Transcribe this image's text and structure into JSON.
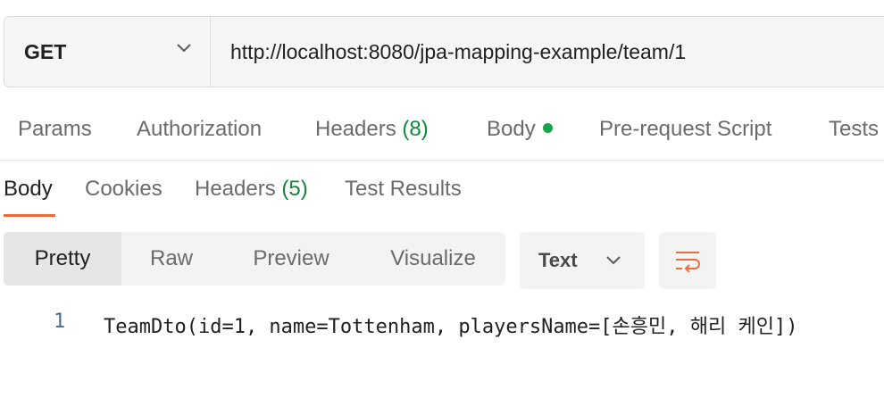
{
  "request": {
    "method": "GET",
    "url": "http://localhost:8080/jpa-mapping-example/team/1"
  },
  "request_tabs": {
    "params": "Params",
    "authorization": "Authorization",
    "headers_label": "Headers",
    "headers_count": "(8)",
    "body": "Body",
    "prerequest": "Pre-request Script",
    "tests": "Tests"
  },
  "response_tabs": {
    "body": "Body",
    "cookies": "Cookies",
    "headers_label": "Headers",
    "headers_count": "(5)",
    "test_results": "Test Results"
  },
  "format": {
    "pretty": "Pretty",
    "raw": "Raw",
    "preview": "Preview",
    "visualize": "Visualize",
    "selected_type": "Text"
  },
  "response_body": {
    "line_number": "1",
    "content": "TeamDto(id=1, name=Tottenham, playersName=[손흥민, 해리 케인])"
  },
  "icons": {
    "method_dropdown": "chevron-down-icon",
    "type_dropdown": "chevron-down-icon",
    "wrap": "wrap-lines-icon"
  },
  "colors": {
    "accent": "#f06b3e",
    "count_green": "#0f8a3a",
    "dot_green": "#17a34a"
  }
}
